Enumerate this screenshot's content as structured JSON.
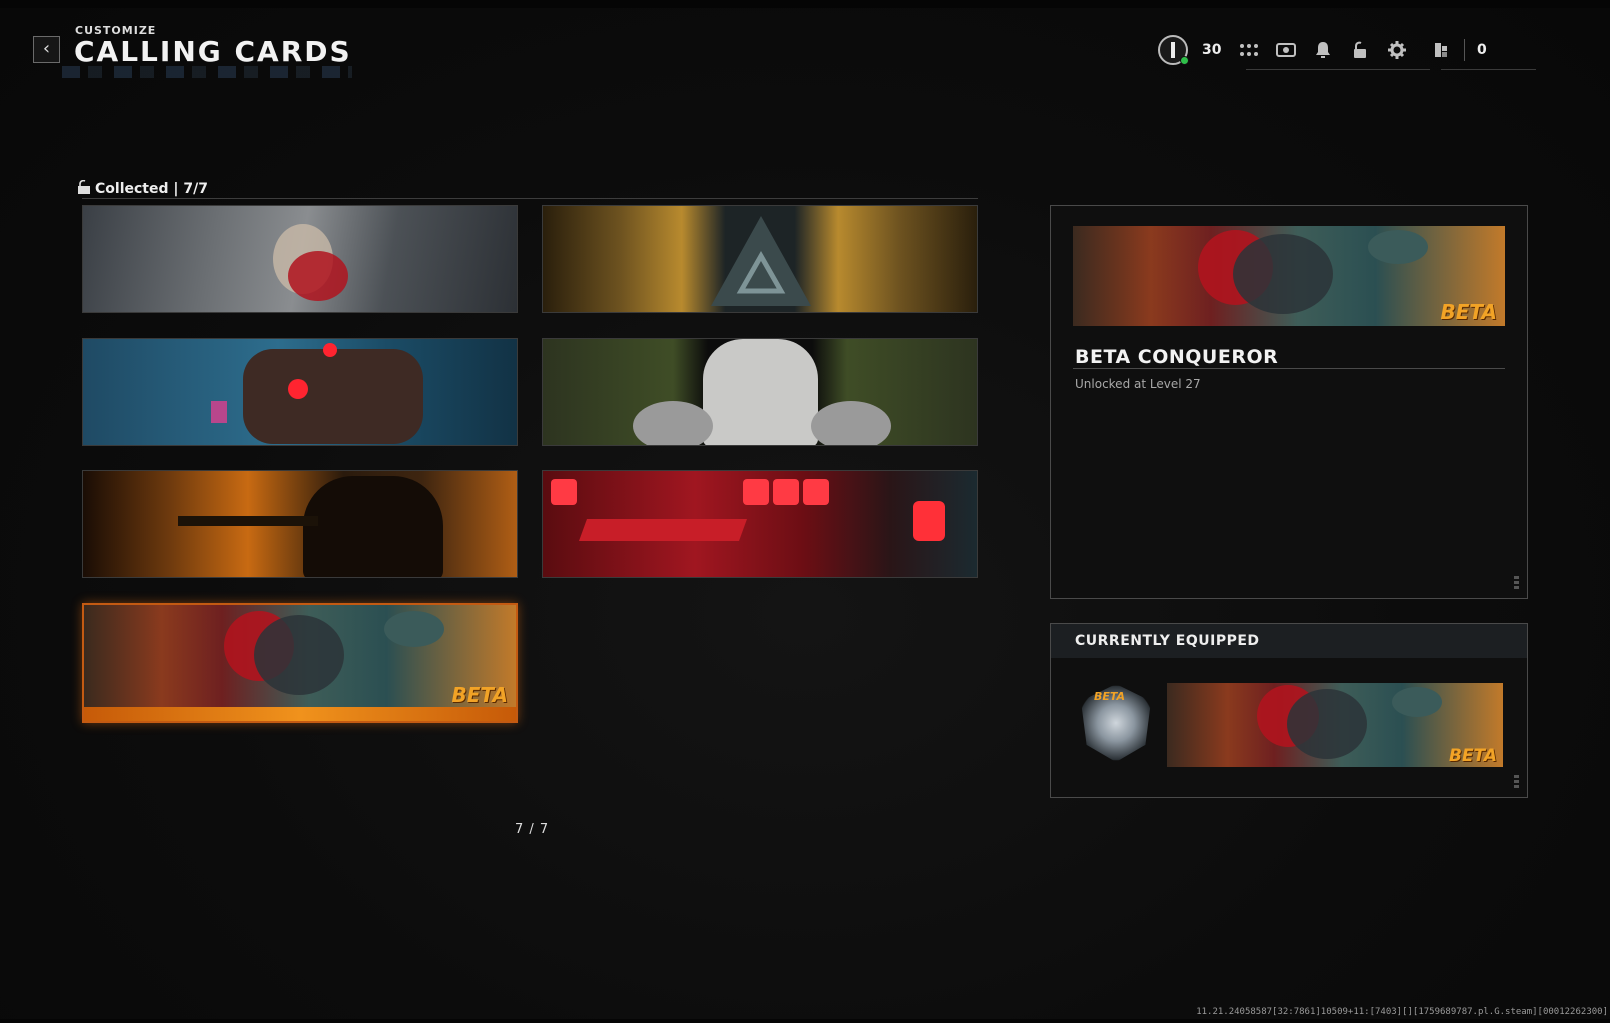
{
  "header": {
    "subtitle": "CUSTOMIZE",
    "title": "CALLING CARDS"
  },
  "status": {
    "level": "30",
    "currency": "0",
    "icons": [
      "grid-icon",
      "store-icon",
      "bell-icon",
      "unlock-icon",
      "gear-icon",
      "currency-icon"
    ]
  },
  "collection": {
    "label": "Collected | 7/7",
    "pager": "7 / 7",
    "cards": [
      {
        "name": "shattered-portrait-card"
      },
      {
        "name": "gold-triangle-card"
      },
      {
        "name": "night-vehicle-card"
      },
      {
        "name": "robot-card"
      },
      {
        "name": "gunner-card"
      },
      {
        "name": "red-lab-card"
      },
      {
        "name": "beta-conqueror-card",
        "tag": "BETA",
        "selected": true
      }
    ]
  },
  "preview": {
    "title": "BETA CONQUEROR",
    "subtitle": "Unlocked at Level 27",
    "tag": "BETA"
  },
  "equipped": {
    "heading": "CURRENTLY EQUIPPED",
    "emblem_tag": "BETA",
    "card_tag": "BETA"
  },
  "build": "11.21.24058587[32:7861]10509+11:[7403][][1759689787.pl.G.steam][00012262300]",
  "colors": {
    "accent_orange": "#f0921c",
    "online_green": "#2fbf4a",
    "beta_gold": "#f2a326"
  }
}
